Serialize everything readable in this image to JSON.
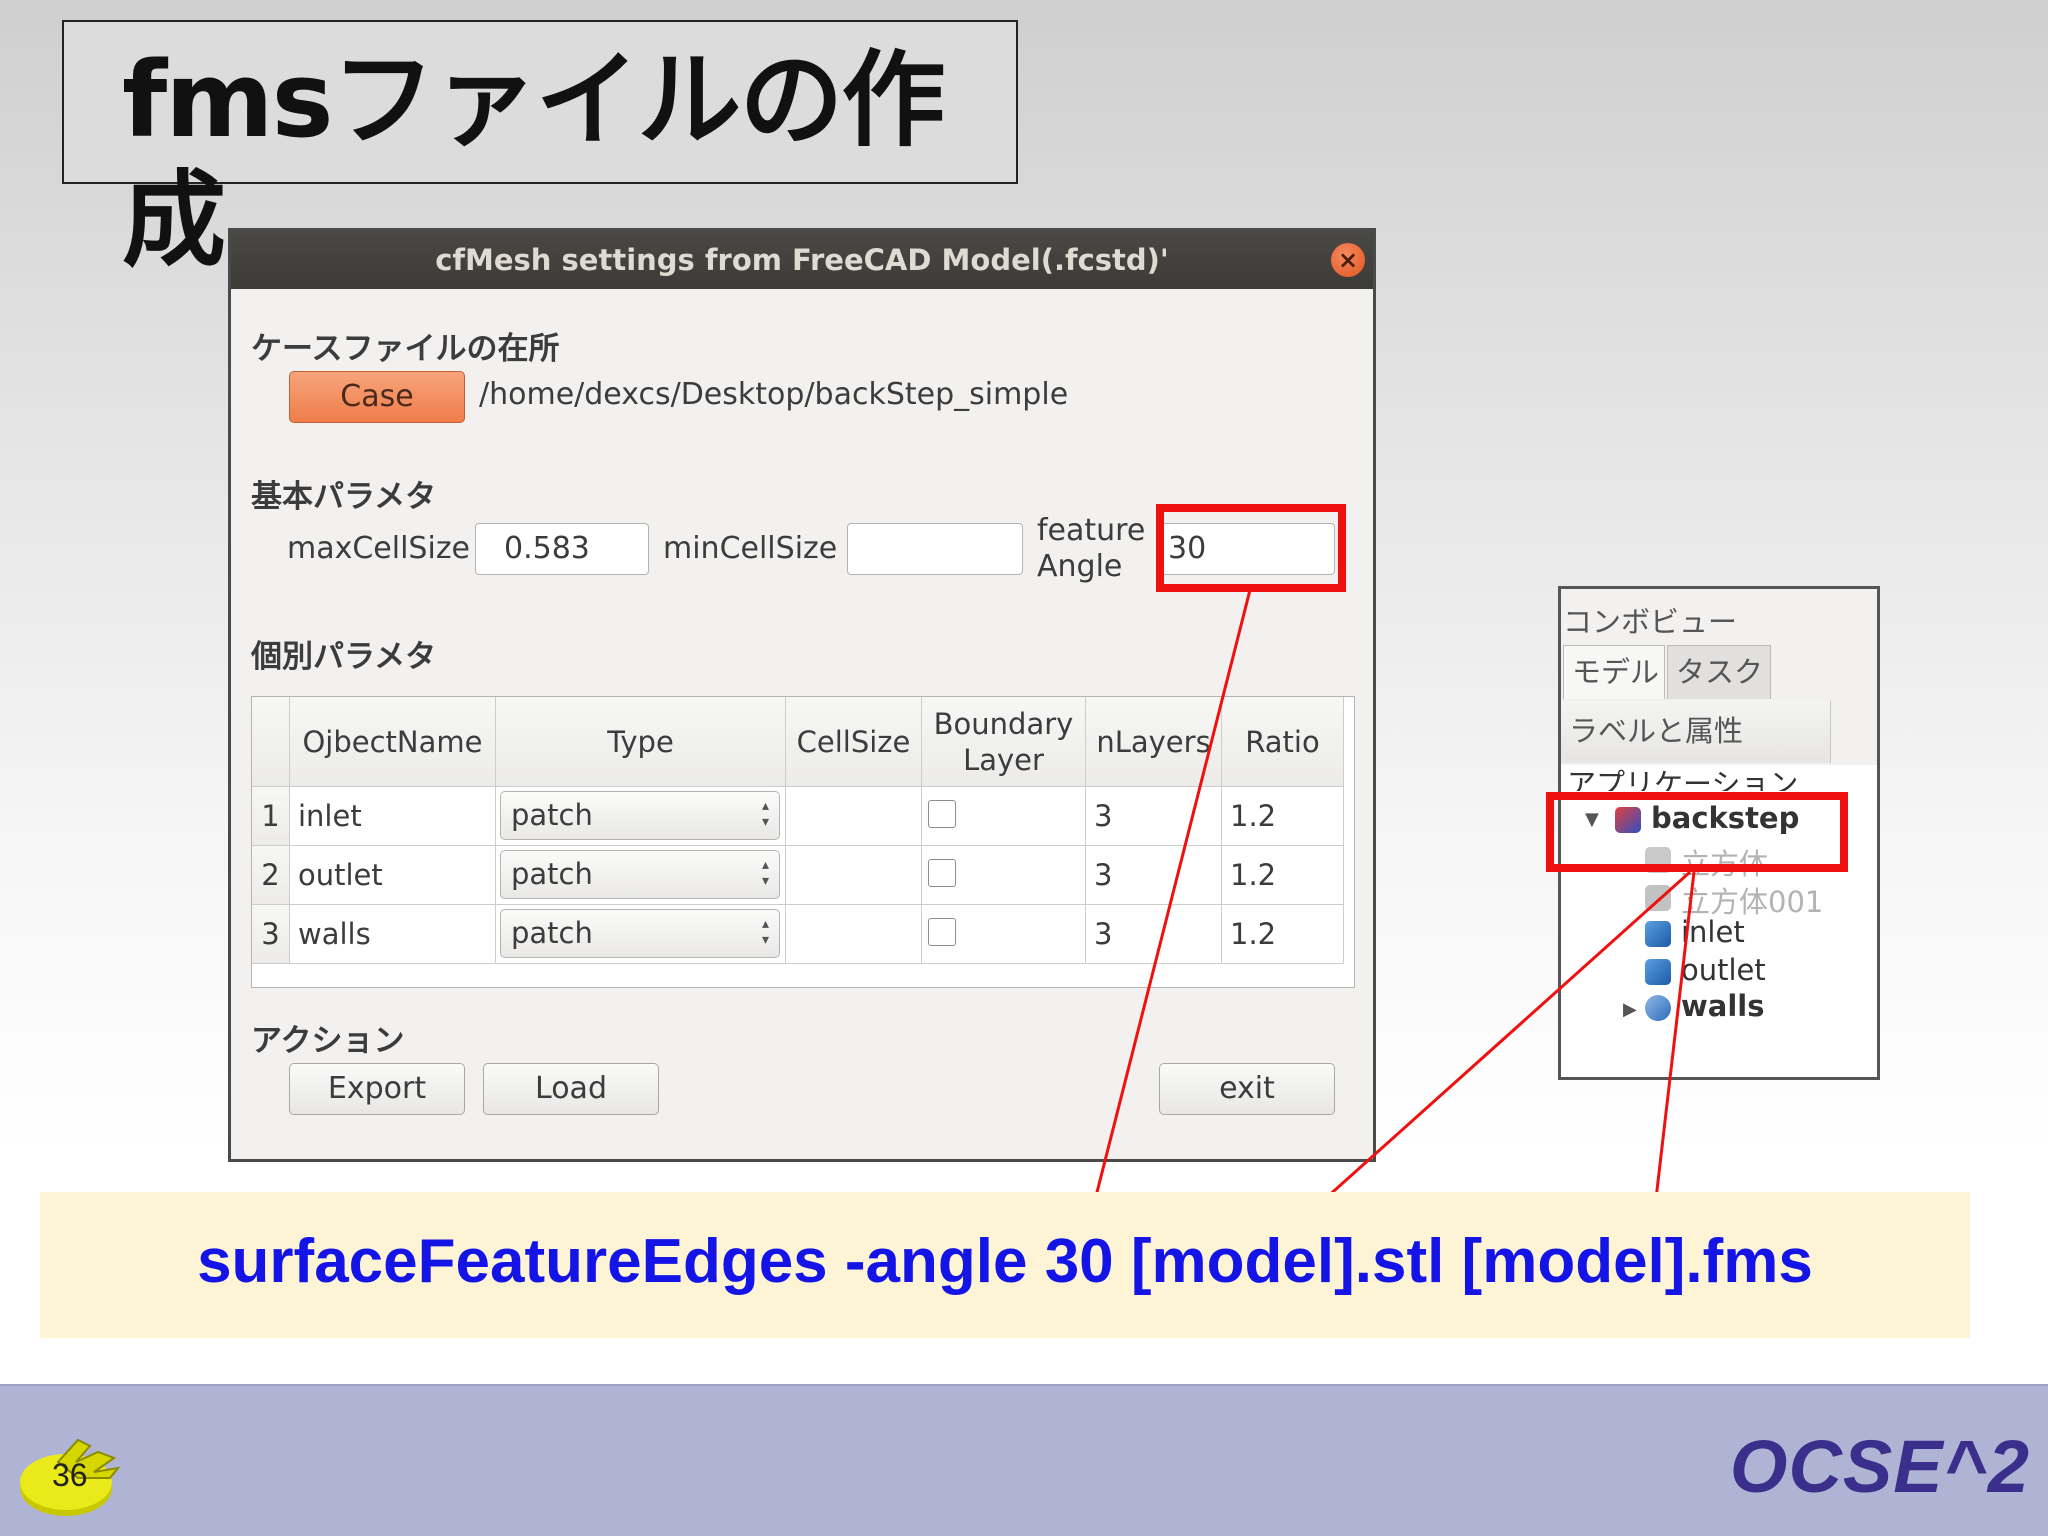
{
  "slide": {
    "title": "fmsファイルの作成",
    "page_number": "36",
    "brand": "OCSE^2"
  },
  "dialog": {
    "title": "cfMesh settings from FreeCAD Model(.fcstd)'",
    "close_icon": "×",
    "case_section": {
      "heading": "ケースファイルの在所",
      "case_button": "Case",
      "path": "/home/dexcs/Desktop/backStep_simple"
    },
    "basic_params": {
      "heading": "基本パラメタ",
      "max_cell_label": "maxCellSize",
      "max_cell_value": "0.583",
      "min_cell_label": "minCellSize",
      "min_cell_value": "",
      "feature_angle_label_1": "feature",
      "feature_angle_label_2": "Angle",
      "feature_angle_value": "30"
    },
    "individual_params": {
      "heading": "個別パラメタ",
      "columns": {
        "object_name": "OjbectName",
        "type": "Type",
        "cell_size": "CellSize",
        "boundary_layer_1": "Boundary",
        "boundary_layer_2": "Layer",
        "n_layers": "nLayers",
        "ratio": "Ratio"
      },
      "rows": [
        {
          "num": "1",
          "name": "inlet",
          "type": "patch",
          "cell_size": "",
          "boundary_layer": false,
          "n_layers": "3",
          "ratio": "1.2"
        },
        {
          "num": "2",
          "name": "outlet",
          "type": "patch",
          "cell_size": "",
          "boundary_layer": false,
          "n_layers": "3",
          "ratio": "1.2"
        },
        {
          "num": "3",
          "name": "walls",
          "type": "patch",
          "cell_size": "",
          "boundary_layer": false,
          "n_layers": "3",
          "ratio": "1.2"
        }
      ]
    },
    "actions": {
      "heading": "アクション",
      "export": "Export",
      "load": "Load",
      "exit": "exit"
    }
  },
  "combo_view": {
    "title": "コンボビュー",
    "tabs": [
      "モデル",
      "タスク"
    ],
    "label_header": "ラベルと属性",
    "application": "アプリケーション",
    "tree": {
      "root": "backstep",
      "items": [
        "立方体",
        "立方体001",
        "inlet",
        "outlet",
        "walls"
      ]
    }
  },
  "command": "surfaceFeatureEdges -angle 30 [model].stl [model].fms",
  "colors": {
    "highlight": "#ef1010",
    "command_text": "#1414e6",
    "banner_bg": "#fdf3d5",
    "footer_bg": "#b0b4d4",
    "case_button": "#ef7d4a",
    "titlebar": "#3c3b37"
  }
}
